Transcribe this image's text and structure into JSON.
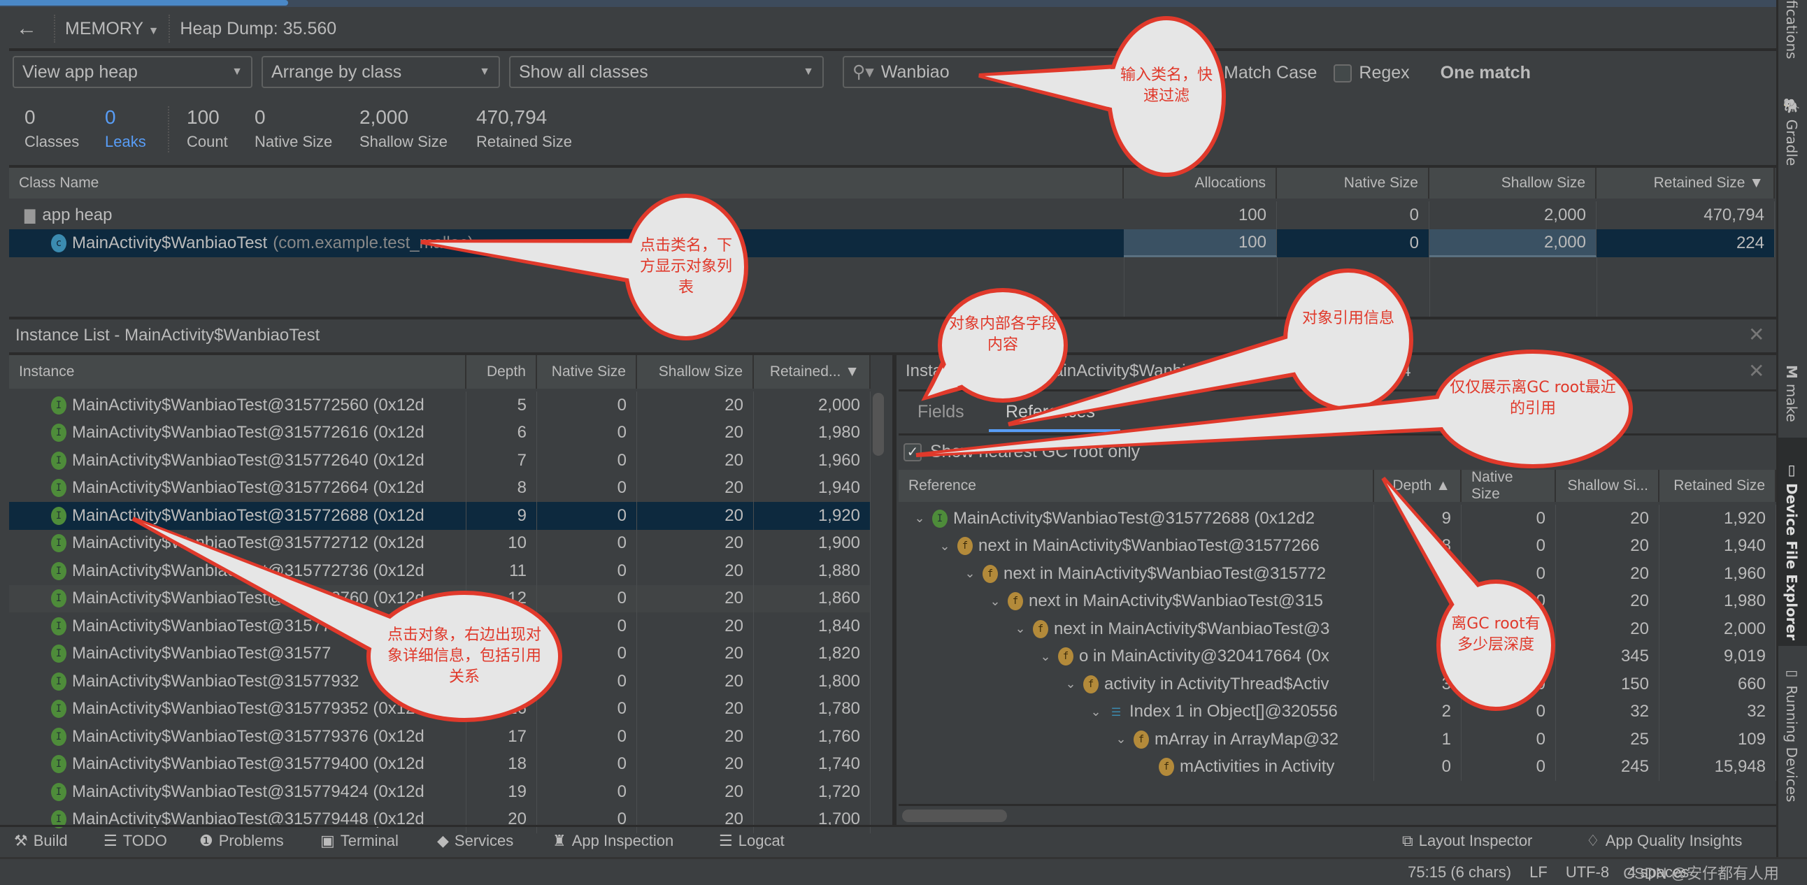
{
  "header": {
    "back_icon": "arrow-left-icon",
    "profiler": "MEMORY",
    "title": "Heap Dump: 35.560"
  },
  "toolbar": {
    "heap": "View app heap",
    "arrange": "Arrange by class",
    "filter": "Show all classes",
    "search_value": "Wanbiao",
    "match_case": "Match Case",
    "match_case_checked": false,
    "regex": "Regex",
    "regex_checked": false,
    "result": "One match"
  },
  "stats": [
    {
      "value": "0",
      "label": "Classes"
    },
    {
      "value": "0",
      "label": "Leaks",
      "color": "#589df6"
    },
    {
      "value": "100",
      "label": "Count"
    },
    {
      "value": "0",
      "label": "Native Size"
    },
    {
      "value": "2,000",
      "label": "Shallow Size"
    },
    {
      "value": "470,794",
      "label": "Retained Size"
    }
  ],
  "class_table": {
    "columns": [
      "Class Name",
      "Allocations",
      "Native Size",
      "Shallow Size",
      "Retained Size ▼"
    ],
    "rows": [
      {
        "name": "app heap",
        "pkg": "",
        "alloc": "100",
        "native": "0",
        "shallow": "2,000",
        "retained": "470,794",
        "icon": "folder-icon"
      },
      {
        "name": "MainActivity$WanbiaoTest",
        "pkg": "(com.example.test_malloc)",
        "alloc": "100",
        "native": "0",
        "shallow": "2,000",
        "retained": "224",
        "icon": "class-icon",
        "selected": true
      }
    ]
  },
  "instance_list": {
    "title": "Instance List - MainActivity$WanbiaoTest",
    "columns": [
      "Instance",
      "Depth",
      "Native Size",
      "Shallow Size",
      "Retained... ▼"
    ],
    "rows": [
      [
        "MainActivity$WanbiaoTest@315772560 (0x12d",
        "5",
        "0",
        "20",
        "2,000"
      ],
      [
        "MainActivity$WanbiaoTest@315772616 (0x12d",
        "6",
        "0",
        "20",
        "1,980"
      ],
      [
        "MainActivity$WanbiaoTest@315772640 (0x12d",
        "7",
        "0",
        "20",
        "1,960"
      ],
      [
        "MainActivity$WanbiaoTest@315772664 (0x12d",
        "8",
        "0",
        "20",
        "1,940"
      ],
      [
        "MainActivity$WanbiaoTest@315772688 (0x12d",
        "9",
        "0",
        "20",
        "1,920"
      ],
      [
        "MainActivity$WanbiaoTest@315772712 (0x12d",
        "10",
        "0",
        "20",
        "1,900"
      ],
      [
        "MainActivity$WanbiaoTest@315772736 (0x12d",
        "11",
        "0",
        "20",
        "1,880"
      ],
      [
        "MainActivity$WanbiaoTest@315772760 (0x12d",
        "12",
        "0",
        "20",
        "1,860"
      ],
      [
        "MainActivity$WanbiaoTest@31577",
        "",
        "0",
        "20",
        "1,840"
      ],
      [
        "MainActivity$WanbiaoTest@31577",
        "",
        "0",
        "20",
        "1,820"
      ],
      [
        "MainActivity$WanbiaoTest@31577932",
        "",
        "0",
        "20",
        "1,800"
      ],
      [
        "MainActivity$WanbiaoTest@315779352 (0x12d",
        "16",
        "0",
        "20",
        "1,780"
      ],
      [
        "MainActivity$WanbiaoTest@315779376 (0x12d",
        "17",
        "0",
        "20",
        "1,760"
      ],
      [
        "MainActivity$WanbiaoTest@315779400 (0x12d",
        "18",
        "0",
        "20",
        "1,740"
      ],
      [
        "MainActivity$WanbiaoTest@315779424 (0x12d",
        "19",
        "0",
        "20",
        "1,720"
      ],
      [
        "MainActivity$WanbiaoTest@315779448 (0x12d",
        "20",
        "0",
        "20",
        "1,700"
      ]
    ],
    "selected_index": 4
  },
  "details": {
    "title": "Instance Details - MainActivity$WanbiaoTest@315772688 (0x12d24",
    "tabs": [
      "Fields",
      "References"
    ],
    "active_tab": 1,
    "nearest_gc": "Show nearest GC root only",
    "nearest_gc_checked": true,
    "columns": [
      "Reference",
      "Depth ▲",
      "Native Size",
      "Shallow Si...",
      "Retained Size"
    ],
    "rows": [
      {
        "level": 0,
        "icon": "instance",
        "label": "MainActivity$WanbiaoTest@315772688 (0x12d2",
        "depth": "9",
        "native": "0",
        "shallow": "20",
        "retained": "1,920"
      },
      {
        "level": 1,
        "icon": "field",
        "label": "next in MainActivity$WanbiaoTest@31577266",
        "depth": "8",
        "native": "0",
        "shallow": "20",
        "retained": "1,940"
      },
      {
        "level": 2,
        "icon": "field",
        "label": "next in MainActivity$WanbiaoTest@315772",
        "depth": "",
        "native": "0",
        "shallow": "20",
        "retained": "1,960"
      },
      {
        "level": 3,
        "icon": "field",
        "label": "next in MainActivity$WanbiaoTest@315",
        "depth": "",
        "native": "0",
        "shallow": "20",
        "retained": "1,980"
      },
      {
        "level": 4,
        "icon": "field",
        "label": "next in MainActivity$WanbiaoTest@3",
        "depth": "",
        "native": "0",
        "shallow": "20",
        "retained": "2,000"
      },
      {
        "level": 5,
        "icon": "field",
        "label": "o in MainActivity@320417664 (0x",
        "depth": "",
        "native": "0",
        "shallow": "345",
        "retained": "9,019"
      },
      {
        "level": 6,
        "icon": "field",
        "label": "activity in ActivityThread$Activ",
        "depth": "3",
        "native": "0",
        "shallow": "150",
        "retained": "660"
      },
      {
        "level": 7,
        "icon": "array",
        "label": "Index 1 in Object[]@320556",
        "depth": "2",
        "native": "0",
        "shallow": "32",
        "retained": "32"
      },
      {
        "level": 8,
        "icon": "field",
        "label": "mArray in ArrayMap@32",
        "depth": "1",
        "native": "0",
        "shallow": "25",
        "retained": "109"
      },
      {
        "level": 9,
        "icon": "field",
        "label": "mActivities in Activity",
        "depth": "0",
        "native": "0",
        "shallow": "245",
        "retained": "15,948",
        "leaf": true
      }
    ]
  },
  "bottom_tools": {
    "left": [
      "Build",
      "TODO",
      "Problems",
      "Terminal",
      "Services",
      "App Inspection",
      "Logcat"
    ],
    "right": [
      "Layout Inspector",
      "App Quality Insights"
    ]
  },
  "status": {
    "position": "75:15 (6 chars)",
    "line_sep": "LF",
    "encoding": "UTF-8",
    "indent": "4 spaces",
    "watermark": "CSDN @安仔都有人用"
  },
  "side_stripe": [
    "fications",
    "Gradle",
    "make",
    "Device File Explorer",
    "Running Devices"
  ],
  "annotations": [
    "输入类名，快速过滤",
    "点击类名，下方显示对象列表",
    "对象内部各字段内容",
    "对象引用信息",
    "仅仅展示离GC root最近的引用",
    "离GC root有多少层深度",
    "点击对象，右边出现对象详细信息，包括引用关系"
  ],
  "colors": {
    "background": "#3c3f41",
    "selection": "#0d293e",
    "accent": "#589df6",
    "annotation": "#e0392b"
  }
}
